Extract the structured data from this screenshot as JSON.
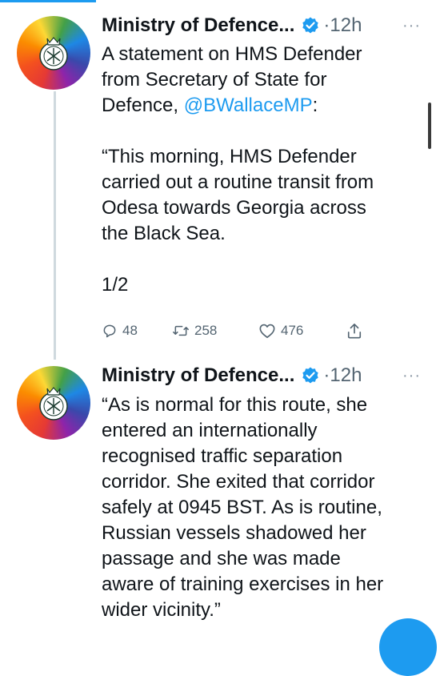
{
  "brand": {
    "accent": "#1d9bf0",
    "text": "#0f1419",
    "muted": "#536471"
  },
  "tweets": [
    {
      "author": "Ministry of Defence...",
      "separator": "·",
      "time": "12h",
      "more": "···",
      "lines": [
        [
          "A statement on HMS Defender"
        ],
        [
          "from Secretary of State for"
        ],
        [
          "Defence, ",
          "@BWallaceMP",
          ":"
        ],
        [
          ""
        ],
        [
          "“This morning, HMS Defender"
        ],
        [
          "carried out a routine transit from"
        ],
        [
          "Odesa towards Georgia across"
        ],
        [
          "the Black Sea."
        ],
        [
          ""
        ],
        [
          "1/2"
        ]
      ],
      "mention": "@BWallaceMP",
      "text_p1": "A statement on HMS Defender",
      "text_p2": "from Secretary of State for",
      "text_p3_pre": "Defence, ",
      "text_p3_post": ":",
      "quote_l1": "“This morning, HMS Defender",
      "quote_l2": "carried out a routine transit from",
      "quote_l3": "Odesa towards Georgia across",
      "quote_l4": "the Black Sea.",
      "counter": "1/2",
      "replies": "48",
      "retweets": "258",
      "likes": "476",
      "icons": [
        "reply-icon",
        "retweet-icon",
        "like-icon",
        "share-icon",
        "verified-icon"
      ]
    },
    {
      "author": "Ministry of Defence...",
      "separator": "·",
      "time": "12h",
      "more": "···",
      "l1": "“As is normal for this route, she",
      "l2": "entered an internationally",
      "l3": "recognised traffic separation",
      "l4": "corridor. She exited that corridor",
      "l5": "safely at 0945 BST. As is routine,",
      "l6": "Russian vessels shadowed her",
      "l7": "passage and she was made",
      "l8": "aware of training exercises in her",
      "l9": "wider vicinity.”"
    }
  ]
}
